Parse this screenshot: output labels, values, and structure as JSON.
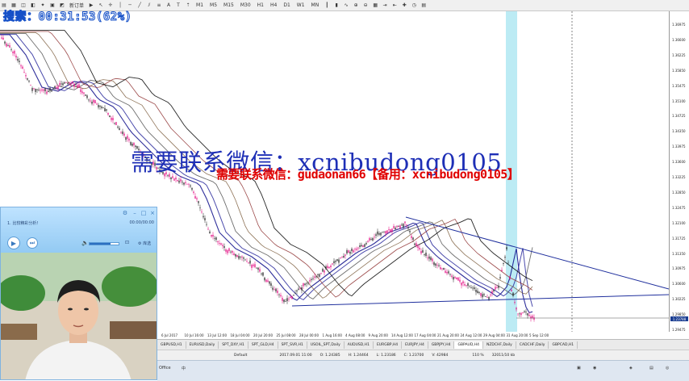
{
  "overlay": {
    "search_text": "搜索：00:31:53(62%)",
    "watermark_blue": "需要联系微信：xcnibudong0105",
    "watermark_red": "需要联系微信：gudaonan66【备用：xcnibudong0105】"
  },
  "toolbar": {
    "new_order_label": "新订单",
    "timeframes": [
      "M1",
      "M5",
      "M15",
      "M30",
      "H1",
      "H4",
      "D1",
      "W1",
      "MN"
    ]
  },
  "price_axis": {
    "labels": [
      "1.36975",
      "1.36600",
      "1.36225",
      "1.35850",
      "1.35475",
      "1.35100",
      "1.34725",
      "1.34350",
      "1.33975",
      "1.33600",
      "1.33225",
      "1.32850",
      "1.32475",
      "1.32100",
      "1.31725",
      "1.31350",
      "1.30975",
      "1.30600",
      "1.30225",
      "1.29850",
      "1.29475"
    ],
    "last_price": "1.23788"
  },
  "time_axis": {
    "labels": [
      "6 Jul 2017",
      "10 Jul 16:00",
      "13 Jul 12:00",
      "18 Jul 04:00",
      "20 Jul 20:00",
      "25 Jul 08:00",
      "28 Jul 00:00",
      "1 Aug 16:00",
      "4 Aug 08:00",
      "9 Aug 20:00",
      "14 Aug 12:00",
      "17 Aug 04:00",
      "21 Aug 20:00",
      "24 Aug 12:00",
      "29 Aug 04:00",
      "31 Aug 20:00",
      "5 Sep 12:00"
    ]
  },
  "tabs": [
    "GBPUSD,H1",
    "EURUSD,Daily",
    "SPT_DXY,H1",
    "SPT_GLD,H4",
    "SPT_SVR,H1",
    "USOIL_SPT,Daily",
    "AUDUSD,H1",
    "EURGBP,H4",
    "EURJPY,H4",
    "GBPJPY,H4",
    "GBPAUD,H4",
    "NZDCHF,Daily",
    "CADCHF,Daily",
    "GBPCAD,H1"
  ],
  "active_tab_index": 10,
  "statusbar": {
    "profile": "Default",
    "datetime": "2017.09.01 11:00",
    "open": "O: 1.24385",
    "high": "H: 1.24464",
    "low": "L: 1.23186",
    "close": "C: 1.23700",
    "volume": "V: 42984",
    "traffic": "32011/10 kb",
    "zoom": "110 %"
  },
  "taskbar": {
    "office_label": "Office",
    "lang_label": "中"
  },
  "player": {
    "title": "1. 比较精彩分析！",
    "time": "00:00/00:00",
    "extra1": "⊡",
    "extra2": "⚙ 库选",
    "volume_level": 0.72
  },
  "colors": {
    "bull": "#1a1a1a",
    "bear": "#e3007d",
    "ma_colors": [
      "#0a0a8a",
      "#2b2b9d",
      "#555555",
      "#7a5a3a",
      "#8c2b2b",
      "#000000"
    ],
    "trendline": "#1f2f9d",
    "highlight": "#9fe3f0",
    "watermark_blue": "#1e2fb6",
    "watermark_red": "#e00000"
  }
}
